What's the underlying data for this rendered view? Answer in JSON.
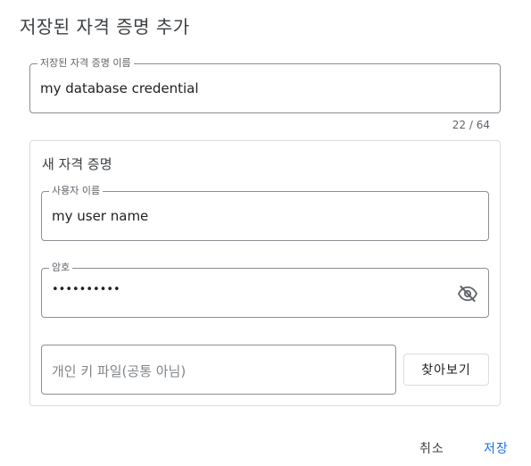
{
  "dialog": {
    "title": "저장된 자격 증명 추가"
  },
  "credential_name": {
    "label": "저장된 자격 증명 이름",
    "value": "my database credential",
    "counter": "22 / 64"
  },
  "new_credential": {
    "title": "새 자격 증명",
    "username": {
      "label": "사용자 이름",
      "value": "my user name"
    },
    "password": {
      "label": "암호",
      "value": "••••••••••",
      "toggle_icon": "eye-off-icon"
    },
    "private_key": {
      "placeholder": "개인 키 파일(공통 아님)",
      "browse_label": "찾아보기"
    }
  },
  "actions": {
    "cancel_label": "취소",
    "save_label": "저장"
  },
  "colors": {
    "accent": "#1a73e8",
    "border": "#8a8f94"
  }
}
